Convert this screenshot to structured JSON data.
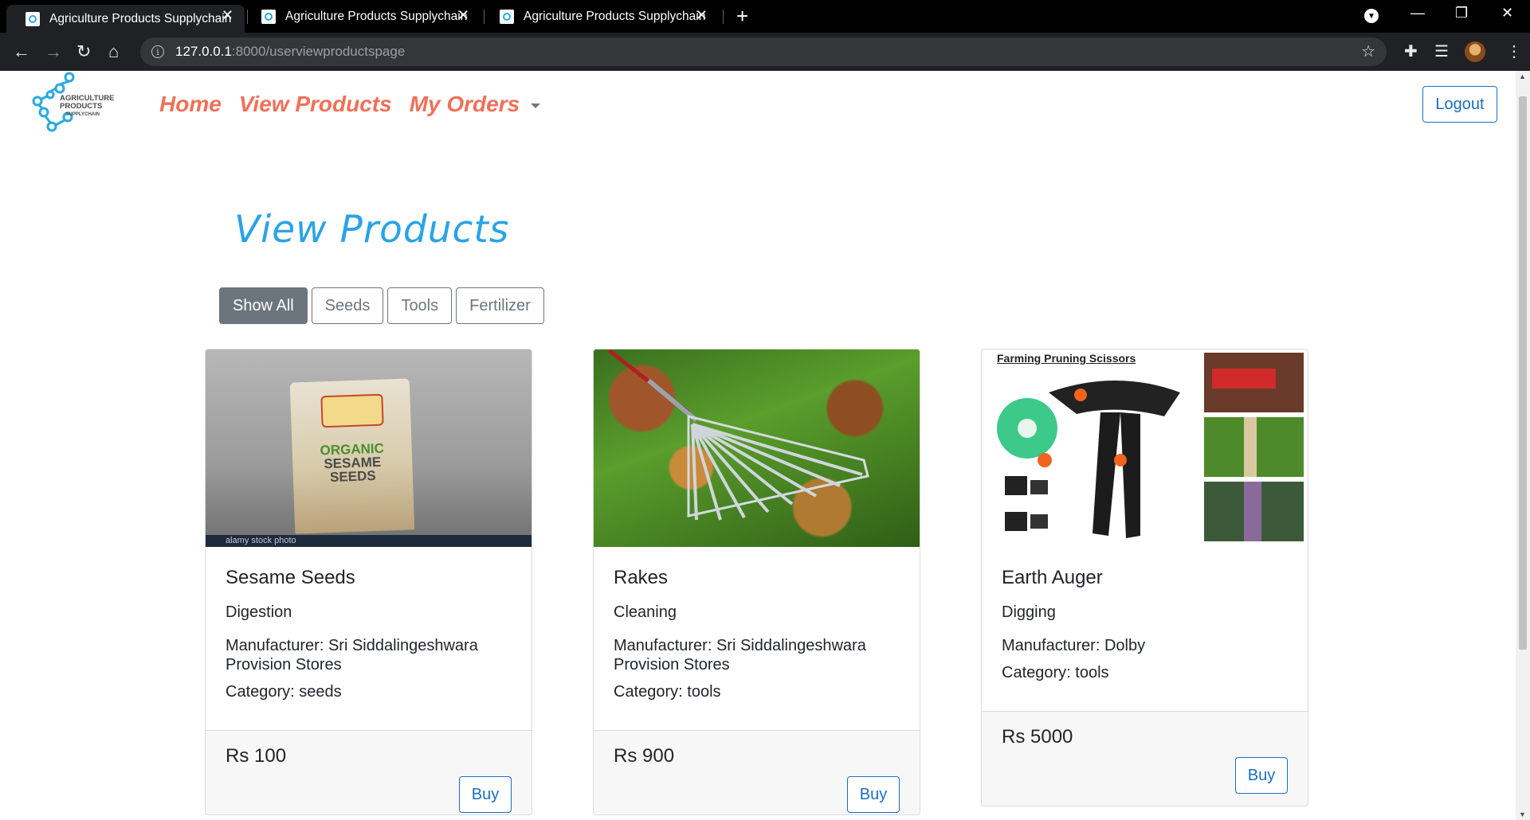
{
  "browser": {
    "tabs": [
      {
        "title": "Agriculture Products Supplychain",
        "active": true
      },
      {
        "title": "Agriculture Products Supplychain",
        "active": false
      },
      {
        "title": "Agriculture Products Supplychain",
        "active": false
      }
    ],
    "url_host": "127.0.0.1",
    "url_path": ":8000/userviewproductspage"
  },
  "site": {
    "logo_lines": [
      "AGRICULTURE",
      "PRODUCTS",
      "SUPPLYCHAIN"
    ],
    "nav": {
      "home": "Home",
      "view_products": "View Products",
      "my_orders": "My Orders"
    },
    "logout": "Logout"
  },
  "main": {
    "heading": "View Products",
    "filters": [
      "Show All",
      "Seeds",
      "Tools",
      "Fertilizer"
    ],
    "active_filter": "Show All",
    "products": [
      {
        "name": "Sesame Seeds",
        "description": "Digestion",
        "manufacturer_line1": "Manufacturer: Sri Siddalingeshwara",
        "manufacturer_line2": "Provision Stores",
        "category": "Category: seeds",
        "price": "Rs 100",
        "buy": "Buy",
        "image_text": {
          "brand": "ORGANIC",
          "line2": "SESAME",
          "line3": "SEEDS",
          "stock": "alamy stock photo"
        }
      },
      {
        "name": "Rakes",
        "description": "Cleaning",
        "manufacturer_line1": "Manufacturer: Sri Siddalingeshwara",
        "manufacturer_line2": "Provision Stores",
        "category": "Category: tools",
        "price": "Rs 900",
        "buy": "Buy"
      },
      {
        "name": "Earth Auger",
        "description": "Digging",
        "manufacturer_line1": "Manufacturer: Dolby",
        "manufacturer_line2": "",
        "category": "Category: tools",
        "price": "Rs 5000",
        "buy": "Buy",
        "image_text": {
          "title": "Farming Pruning Scissors"
        }
      }
    ]
  },
  "colors": {
    "nav_link": "#f16f57",
    "heading": "#2aa3e6",
    "primary_outline": "#1b6ec2",
    "secondary": "#6c757d"
  }
}
